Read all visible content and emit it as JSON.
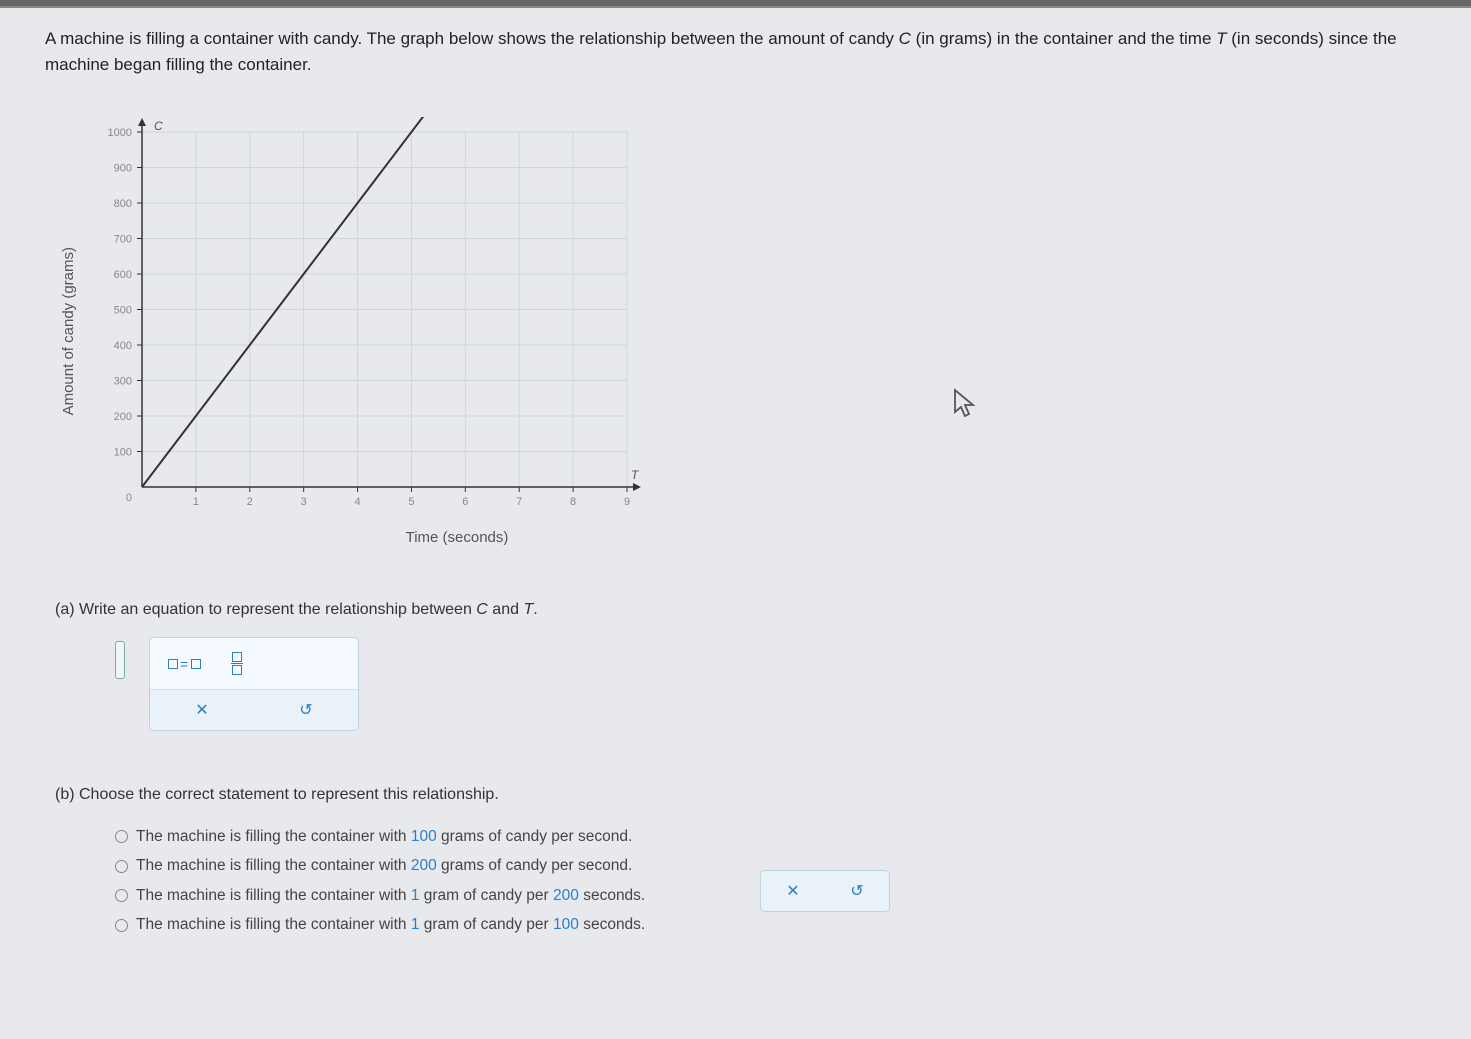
{
  "problem": {
    "line1_a": "A machine is filling a container with candy. The graph below shows the relationship between the amount of candy ",
    "var_c": "C",
    "line1_b": " (in grams) in the container and the time ",
    "var_t": "T",
    "line2": " (in seconds) since the machine began filling the container."
  },
  "chart_data": {
    "type": "line",
    "title": "",
    "xlabel": "Time (seconds)",
    "ylabel": "Amount of candy (grams)",
    "x": [
      0,
      1,
      2,
      3,
      4,
      5
    ],
    "y": [
      0,
      200,
      400,
      600,
      800,
      1000
    ],
    "xlim": [
      0,
      9
    ],
    "ylim": [
      0,
      1000
    ],
    "x_ticks": [
      1,
      2,
      3,
      4,
      5,
      6,
      7,
      8,
      9
    ],
    "y_ticks": [
      100,
      200,
      300,
      400,
      500,
      600,
      700,
      800,
      900,
      1000
    ],
    "y_axis_letter": "C",
    "x_axis_letter": "T",
    "origin_label": "0"
  },
  "part_a": {
    "label": "(a) Write an equation to represent the relationship between ",
    "var_c": "C",
    "and": " and ",
    "var_t": "T",
    "period": ".",
    "tools": {
      "eq_label": "=",
      "reset_icon": "↺",
      "clear_icon": "✕"
    }
  },
  "part_b": {
    "label": "(b) Choose the correct statement to represent this relationship.",
    "choices": [
      {
        "pre": "The machine is filling the container with ",
        "num": "100",
        "post": " grams of candy per second."
      },
      {
        "pre": "The machine is filling the container with ",
        "num": "200",
        "post": " grams of candy per second."
      },
      {
        "pre": "The machine is filling the container with ",
        "num": "1",
        "mid": " gram of candy per ",
        "num2": "200",
        "post": " seconds."
      },
      {
        "pre": "The machine is filling the container with ",
        "num": "1",
        "mid": " gram of candy per ",
        "num2": "100",
        "post": " seconds."
      }
    ]
  },
  "action": {
    "clear": "✕",
    "reset": "↺"
  }
}
